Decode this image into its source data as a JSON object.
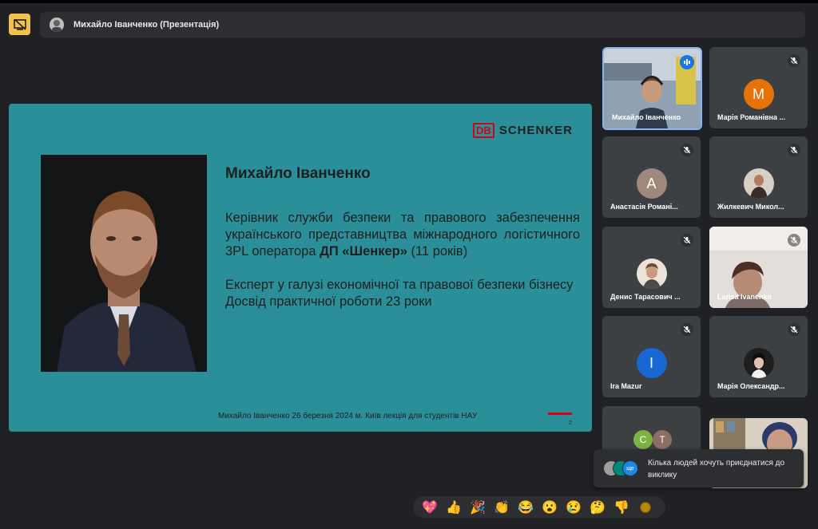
{
  "presenter_bar": {
    "label": "Михайло Іванченко (Презентація)"
  },
  "slide": {
    "logo_db": "DB",
    "logo_text": "SCHENKER",
    "name": "Михайло Іванченко",
    "line1_pre": "Керівник служби безпеки та правового забезпечення українського представництва міжнародного логістичного 3PL оператора ",
    "line1_bold": "ДП «Шенкер»",
    "line1_post": " (11 років)",
    "line2": "Експерт у галузі економічної та правової безпеки бізнесу",
    "line3": "Досвід практичної роботи 23 роки",
    "footer": "Михайло Іванченко 26 березня 2024 м. Київ лекція для студентів НАУ",
    "page": "2"
  },
  "participants": [
    {
      "name": "Михайло Іванченко"
    },
    {
      "name": "Марія Романівна ...",
      "initial": "M",
      "color": "#e8710a"
    },
    {
      "name": "Анастасія Романі...",
      "initial": "A",
      "color": "#a1887f"
    },
    {
      "name": "Жилкевич Микол..."
    },
    {
      "name": "Денис Тарасович ..."
    },
    {
      "name": "Larisa Ivanenko"
    },
    {
      "name": "Ira Mazur",
      "initial": "I",
      "color": "#1967d2"
    },
    {
      "name": "Марія Олександр..."
    },
    {
      "initial_c": "C",
      "initial_t": "T"
    }
  ],
  "toast": {
    "text": "Кілька людей хочуть приєднатися до виклику",
    "badge": "ще"
  },
  "reactions": [
    "💖",
    "👍",
    "🎉",
    "👏",
    "😂",
    "😮",
    "😢",
    "🤔",
    "👎"
  ]
}
